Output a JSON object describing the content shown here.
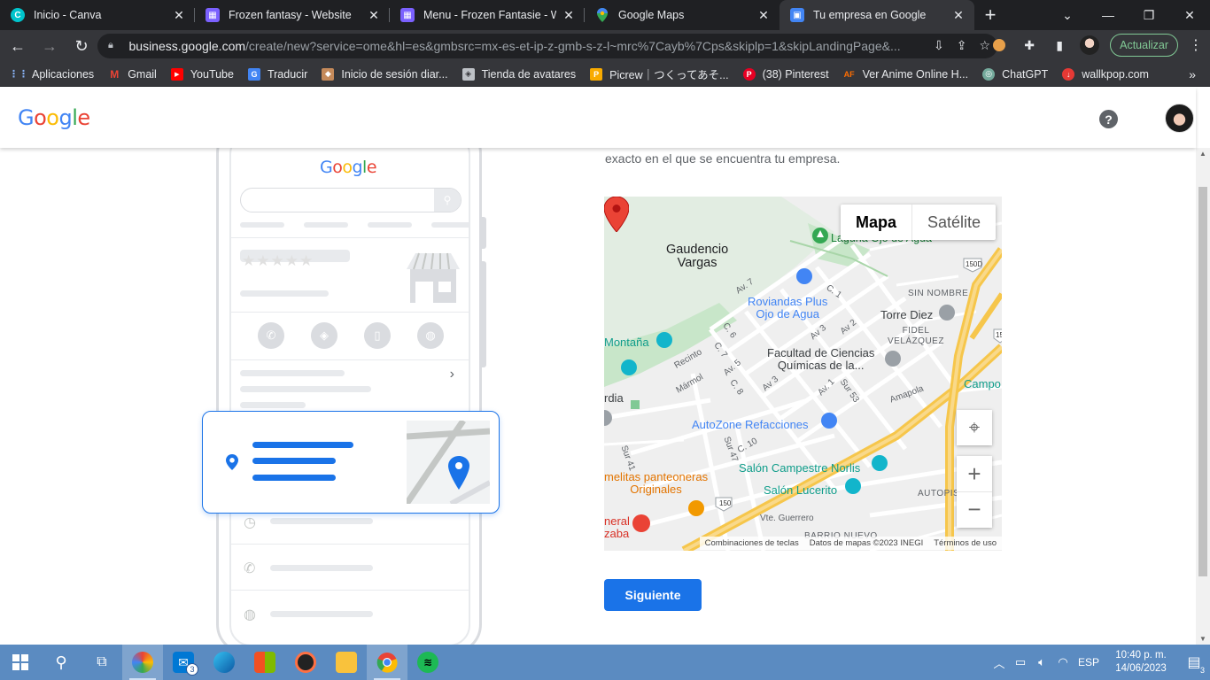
{
  "browser": {
    "tabs": [
      {
        "title": "Inicio - Canva",
        "favicon_color": "#00c4cc",
        "glyph": "C"
      },
      {
        "title": "Frozen fantasy - Website",
        "favicon_color": "#7b61ff",
        "glyph": "▦"
      },
      {
        "title": "Menu - Frozen Fantasie - Website",
        "favicon_color": "#7b61ff",
        "glyph": "▦"
      },
      {
        "title": "Google Maps",
        "favicon_color": "#34a853",
        "glyph": "⬤"
      },
      {
        "title": "Tu empresa en Google",
        "favicon_color": "#4285f4",
        "glyph": "▣"
      }
    ],
    "active_tab_index": 4,
    "url_host": "business.google.com",
    "url_path": "/create/new?service=ome&hl=es&gmbsrc=mx-es-et-ip-z-gmb-s-z-l~mrc%7Cayb%7Cps&skiplp=1&skipLandingPage&...",
    "update_label": "Actualizar",
    "bookmarks": [
      {
        "label": "Aplicaciones",
        "color": "#4285f4",
        "glyph": "⋮⋮"
      },
      {
        "label": "Gmail",
        "color": "#ea4335",
        "glyph": "M"
      },
      {
        "label": "YouTube",
        "color": "#ff0000",
        "glyph": "▶"
      },
      {
        "label": "Traducir",
        "color": "#4285f4",
        "glyph": "G"
      },
      {
        "label": "Inicio de sesión diar...",
        "color": "#c58a5a",
        "glyph": "◆"
      },
      {
        "label": "Tienda de avatares",
        "color": "#9aa0a6",
        "glyph": "◈"
      },
      {
        "label": "Picrew｜つくってあそ...",
        "color": "#f9ab00",
        "glyph": "P"
      },
      {
        "label": "(38) Pinterest",
        "color": "#e60023",
        "glyph": "P"
      },
      {
        "label": "Ver Anime Online H...",
        "color": "#ff6d00",
        "glyph": "AF"
      },
      {
        "label": "ChatGPT",
        "color": "#74aa9c",
        "glyph": "◎"
      },
      {
        "label": "wallkpop.com",
        "color": "#e53935",
        "glyph": "↓"
      }
    ]
  },
  "header": {
    "logo_letters": [
      "G",
      "o",
      "o",
      "g",
      "l",
      "e"
    ],
    "help_glyph": "?"
  },
  "illustration": {
    "mini_logo_letters": [
      "G",
      "o",
      "o",
      "g",
      "l",
      "e"
    ],
    "stars": "★★★★★"
  },
  "main": {
    "intro_text": "exacto en el que se encuentra tu empresa.",
    "map": {
      "toggle_map": "Mapa",
      "toggle_satellite": "Satélite",
      "labels": {
        "gaudencio": "Gaudencio\nVargas",
        "laguna": "Laguna Ojo de Agua",
        "roviandas": "Roviandas Plus\nOjo de Agua",
        "torre_diez": "Torre Diez",
        "sin_nombre": "SIN NOMBRE",
        "fidel": "FIDEL\nVELÁZQUEZ",
        "montana": "Montaña",
        "facultad": "Facultad de Ciencias\nQuímicas de la...",
        "campo": "Campo",
        "autozone": "AutoZone Refacciones",
        "salon_norlis": "Salón Campestre Norlis",
        "salon_lucerito": "Salón Lucerito",
        "panteoneras": "melitas panteoneras\nOriginales",
        "autopis": "AUTOPIS",
        "hospital": "neral\nzaba",
        "ardia": "rdia",
        "vte_guerrero": "Vte. Guerrero",
        "barrio_nuevo": "BARRIO NUEVO",
        "av7": "Av. 7",
        "c1": "C. 1",
        "c6": "C. 6",
        "c7": "C. 7",
        "av5": "Av. 5",
        "av3a": "Av 3",
        "av2": "Av 2",
        "av3b": "Av 3",
        "c8": "C. 8",
        "av1": "Av. 1",
        "sur53": "Sur 53",
        "amapola": "Amapola",
        "recinto": "Recinto",
        "marmol": "Mármol",
        "c10": "C. 10",
        "sur47": "Sur 47",
        "sur41": "Sur 41",
        "hw150d": "150D",
        "hw150": "150",
        "hw15": "15"
      },
      "footer": [
        "Combinaciones de teclas",
        "Datos de mapas ©2023 INEGI",
        "Términos de uso"
      ],
      "colors": {
        "road": "#ffffff",
        "highway": "#f6c64b",
        "park": "#c8e6c9",
        "block": "#e8e8e8"
      }
    },
    "next_button": "Siguiente"
  },
  "taskbar": {
    "apps": [
      "start",
      "search",
      "task-view",
      "photos",
      "mail",
      "edge",
      "store",
      "media",
      "explorer",
      "chrome",
      "spotify"
    ],
    "mail_badge": "3",
    "language": "ESP",
    "time": "10:40 p. m.",
    "date": "14/06/2023",
    "notification_count": "3"
  }
}
